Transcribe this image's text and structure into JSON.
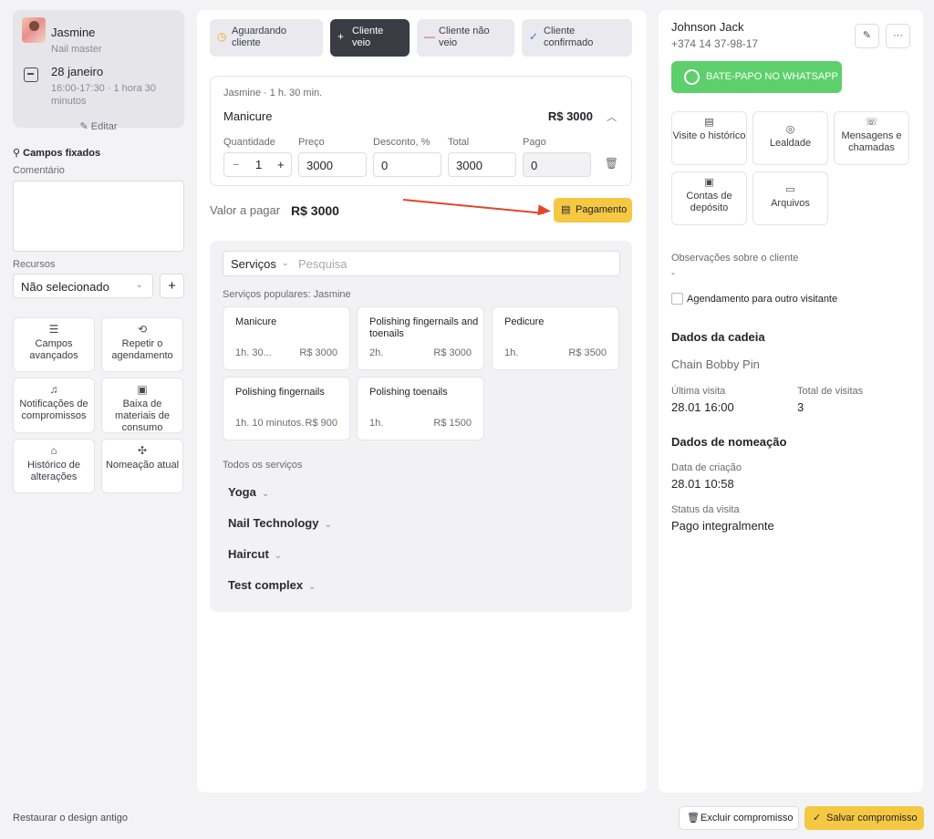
{
  "master": {
    "name": "Jasmine",
    "role": "Nail master"
  },
  "appointment": {
    "date": "28 janeiro",
    "time": "16:00-17:30 · 1 hora 30 minutos",
    "edit_label": "Editar"
  },
  "left": {
    "fixed_fields_title": "Campos fixados",
    "comment_label": "Comentário",
    "resources_label": "Recursos",
    "resource_value": "Não selecionado",
    "add_label": "+",
    "actions": [
      {
        "label": "Campos avançados",
        "icon": "list-icon"
      },
      {
        "label": "Repetir o agendamento",
        "icon": "repeat-icon"
      },
      {
        "label": "Notificações de compromissos",
        "icon": "bell-icon"
      },
      {
        "label": "Baixa de materiais de consumo",
        "icon": "box-icon"
      },
      {
        "label": "Histórico de alterações",
        "icon": "history-icon"
      },
      {
        "label": "Nomeação atual",
        "icon": "puzzle-icon"
      }
    ],
    "restore_link": "Restaurar o design antigo"
  },
  "status_buttons": [
    {
      "label": "Aguardando cliente",
      "icon": "clock-icon",
      "color": "#f5a623"
    },
    {
      "label": "Cliente veio",
      "icon": "plus-icon",
      "color": "#ffffff"
    },
    {
      "label": "Cliente não veio",
      "icon": "minus-icon",
      "color": "#e2452b"
    },
    {
      "label": "Cliente confirmado",
      "icon": "check-icon",
      "color": "#4a6cf7"
    }
  ],
  "service": {
    "meta": "Jasmine · 1 h. 30 min.",
    "name": "Manicure",
    "price": "R$ 3000",
    "labels": {
      "qty": "Quantidade",
      "price": "Preço",
      "discount": "Desconto, %",
      "total": "Total",
      "paid": "Pago"
    },
    "qty": "1",
    "unit_price": "3000",
    "discount": "0",
    "total": "3000",
    "paid": "0"
  },
  "payment": {
    "label": "Valor a pagar",
    "value": "R$ 3000",
    "button": "Pagamento"
  },
  "catalog": {
    "category_select": "Serviços",
    "search_placeholder": "Pesquisa",
    "popular_label": "Serviços populares: Jasmine",
    "popular": [
      {
        "name": "Manicure",
        "duration": "1h. 30...",
        "price": "R$ 3000"
      },
      {
        "name": "Polishing fingernails and toenails",
        "duration": "2h.",
        "price": "R$ 3000"
      },
      {
        "name": "Pedicure",
        "duration": "1h.",
        "price": "R$ 3500"
      },
      {
        "name": "Polishing fingernails",
        "duration": "1h. 10 minutos.",
        "price": "R$ 900"
      },
      {
        "name": "Polishing toenails",
        "duration": "1h.",
        "price": "R$ 1500"
      }
    ],
    "all_label": "Todos os serviços",
    "categories": [
      "Yoga",
      "Nail Technology",
      "Haircut",
      "Test complex"
    ]
  },
  "client": {
    "name": "Johnson Jack",
    "phone": "+374 14 37-98-17",
    "whatsapp_label": "BATE-PAPO NO WHATSAPP",
    "tiles": [
      {
        "label": "Visite o histórico",
        "icon": "history-icon"
      },
      {
        "label": "Lealdade",
        "icon": "loyalty-icon"
      },
      {
        "label": "Mensagens e chamadas",
        "icon": "phone-icon"
      },
      {
        "label": "Contas de depósito",
        "icon": "wallet-icon"
      },
      {
        "label": "Arquivos",
        "icon": "folder-icon"
      }
    ],
    "notes_label": "Observações sobre o cliente",
    "notes_value": "-",
    "other_visitor_label": "Agendamento para outro visitante",
    "chain_title": "Dados da cadeia",
    "chain_name": "Chain Bobby Pin",
    "last_visit_label": "Última visita",
    "last_visit_value": "28.01 16:00",
    "total_visits_label": "Total de visitas",
    "total_visits_value": "3",
    "appt_title": "Dados de nomeação",
    "created_label": "Data de criação",
    "created_value": "28.01 10:58",
    "visit_status_label": "Status da visita",
    "visit_status_value": "Pago integralmente"
  },
  "footer": {
    "delete_label": "Excluir compromisso",
    "save_label": "Salvar compromisso"
  },
  "colors": {
    "accent": "#f5c842",
    "whatsapp": "#5dd06b",
    "arrow": "#e2452b",
    "dark_button": "#3a3c44"
  }
}
